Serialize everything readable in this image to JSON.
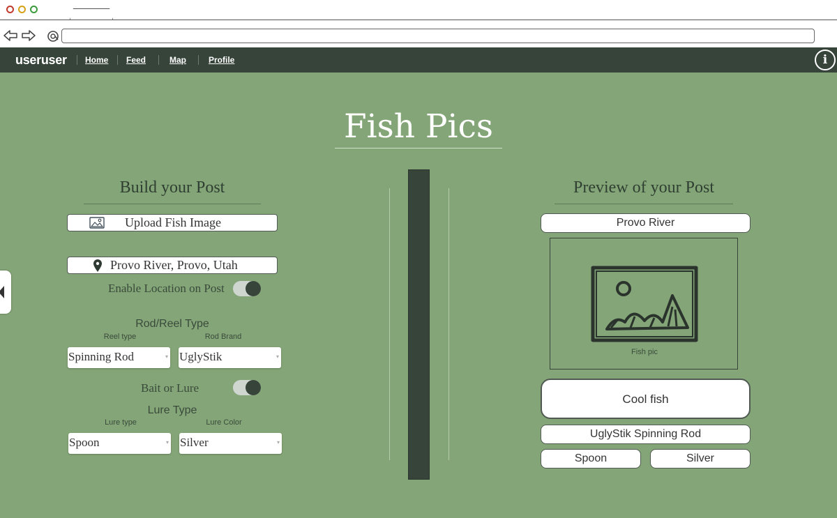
{
  "nav": {
    "brand": "useruser",
    "links": [
      "Home",
      "Feed",
      "Map",
      "Profile"
    ]
  },
  "page_title": "Fish Pics",
  "build": {
    "title": "Build your Post",
    "upload_label": "Upload Fish Image",
    "location_value": "Provo River, Provo, Utah",
    "enable_location_label": "Enable Location on Post",
    "enable_location_on": true,
    "rod_reel_label": "Rod/Reel Type",
    "reel_type_label": "Reel type",
    "rod_brand_label": "Rod Brand",
    "reel_type_value": "Spinning Rod",
    "rod_brand_value": "UglyStik",
    "bait_or_lure_label": "Bait or Lure",
    "bait_or_lure_on": true,
    "lure_type_group_label": "Lure Type",
    "lure_type_label": "Lure type",
    "lure_color_label": "Lure Color",
    "lure_type_value": "Spoon",
    "lure_color_value": "Silver"
  },
  "preview": {
    "title": "Preview of your Post",
    "location": "Provo River",
    "image_caption": "Fish pic",
    "caption": "Cool fish",
    "rod": "UglyStik Spinning Rod",
    "lure_type": "Spoon",
    "lure_color": "Silver"
  },
  "colors": {
    "nav_bg": "#36443a",
    "main_bg": "#84a577",
    "title_text": "#ffffff"
  }
}
